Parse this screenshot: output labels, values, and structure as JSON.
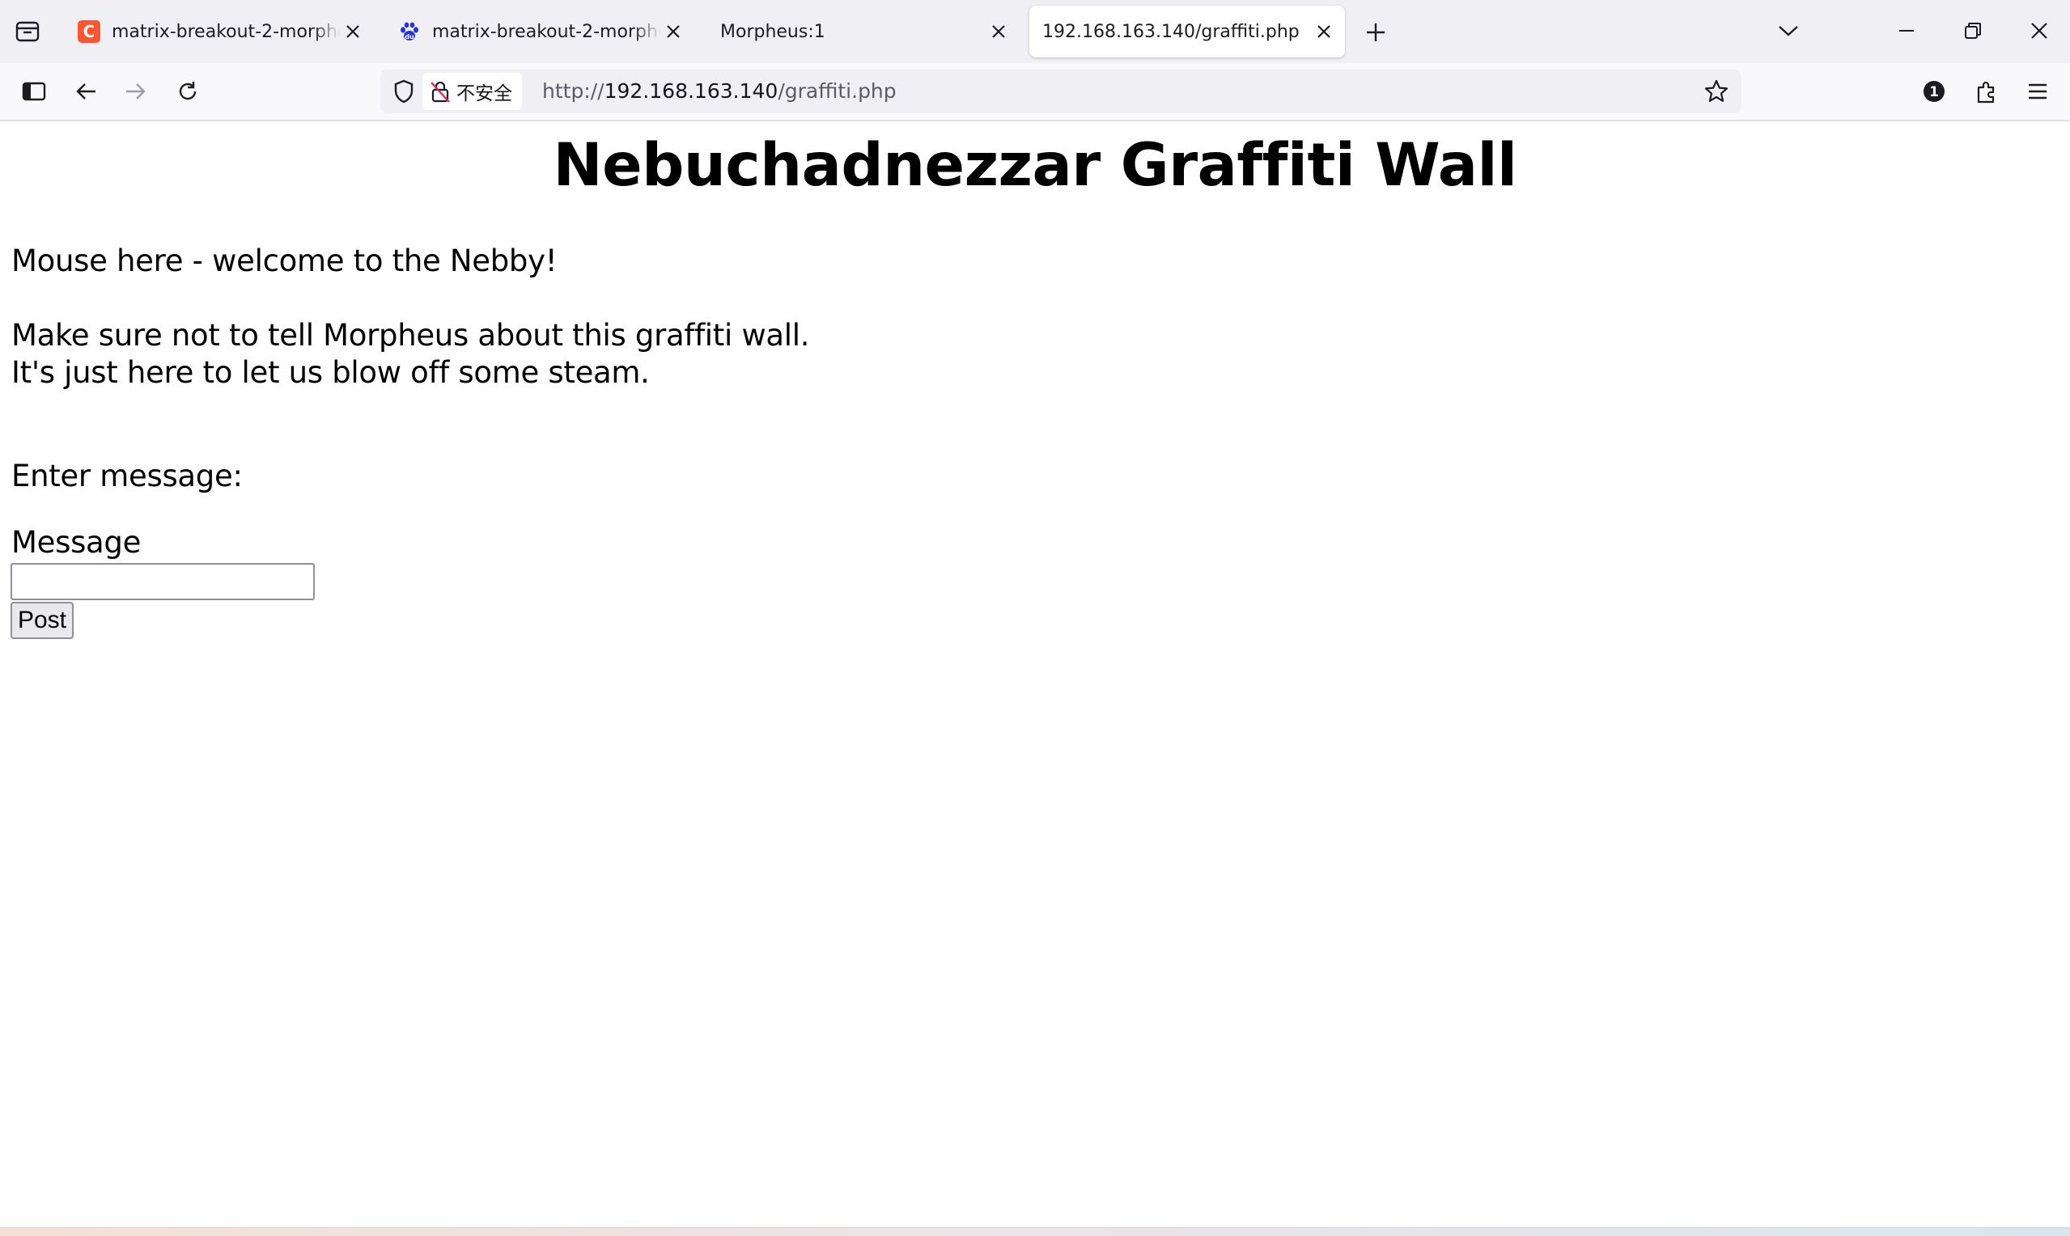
{
  "browser": {
    "tabs": [
      {
        "title": "matrix-breakout-2-morpheus",
        "favicon": "csdn-icon",
        "favicon_color": "#fc5531",
        "active": false
      },
      {
        "title": "matrix-breakout-2-morpheus",
        "favicon": "baidu-paw-icon",
        "favicon_color": "#2932e1",
        "active": false
      },
      {
        "title": "Morpheus:1",
        "favicon": "",
        "active": false
      },
      {
        "title": "192.168.163.140/graffiti.php",
        "favicon": "",
        "active": true
      }
    ],
    "identity_label": "不安全",
    "url": {
      "scheme": "http://",
      "host": "192.168.163.140",
      "path": "/graffiti.php"
    },
    "toolbar_badge": "1"
  },
  "page": {
    "title": "Nebuchadnezzar Graffiti Wall",
    "graffiti_lines": [
      "Mouse here - welcome to the Nebby!",
      "Make sure not to tell Morpheus about this graffiti wall.",
      "It's just here to let us blow off some steam."
    ],
    "form": {
      "prompt": "Enter message:",
      "field_label": "Message",
      "field_value": "",
      "submit_label": "Post"
    }
  },
  "colors": {
    "tabstrip_bg": "#f0f0f4",
    "navbar_bg": "#f9f9fb",
    "urlbar_bg": "#f0f0f4",
    "page_bg": "#ffffff",
    "text": "#000000",
    "url_dim": "#5b5b66"
  }
}
